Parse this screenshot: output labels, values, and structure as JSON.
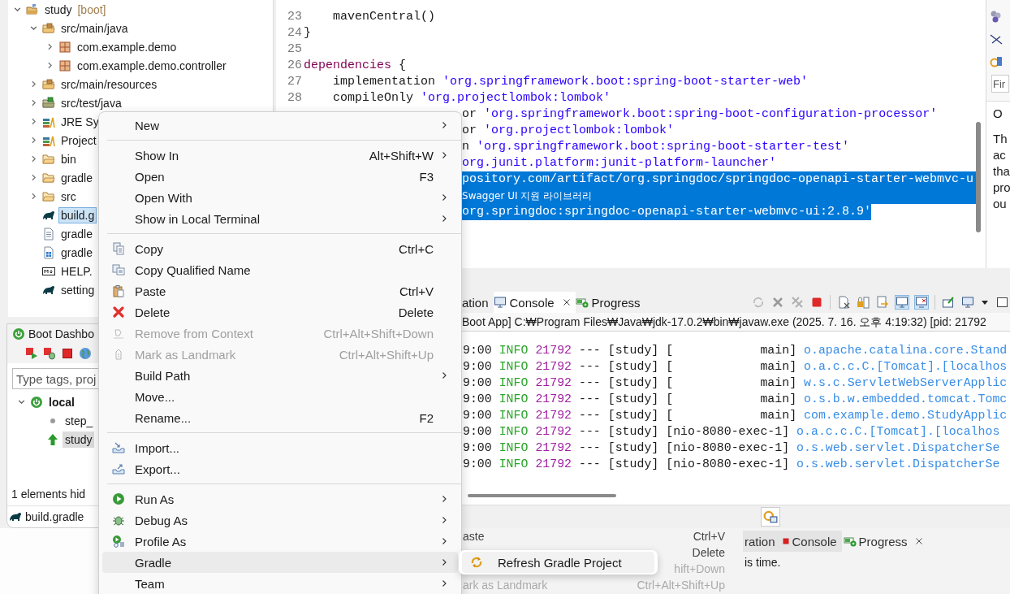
{
  "package_explorer": {
    "tree": [
      {
        "label": "study",
        "decoration": "[boot]",
        "kind": "project",
        "expanded": true,
        "selected": false,
        "children": [
          {
            "label": "src/main/java",
            "kind": "source-folder",
            "expanded": true,
            "selected": false,
            "children": [
              {
                "label": "com.example.demo",
                "kind": "package",
                "expanded": false,
                "selected": false
              },
              {
                "label": "com.example.demo.controller",
                "kind": "package",
                "expanded": false,
                "selected": false
              }
            ]
          },
          {
            "label": "src/main/resources",
            "kind": "source-folder",
            "expanded": false,
            "selected": false
          },
          {
            "label": "src/test/java",
            "kind": "test-folder",
            "expanded": false,
            "selected": false
          },
          {
            "label": "JRE Sy",
            "kind": "library",
            "expanded": false,
            "selected": false
          },
          {
            "label": "Project",
            "kind": "library",
            "expanded": false,
            "selected": false
          },
          {
            "label": "bin",
            "kind": "folder",
            "expanded": false,
            "selected": false
          },
          {
            "label": "gradle",
            "kind": "folder",
            "expanded": false,
            "selected": false
          },
          {
            "label": "src",
            "kind": "folder",
            "expanded": false,
            "selected": false
          },
          {
            "label": "build.g",
            "kind": "gradle-file",
            "selected": true
          },
          {
            "label": "gradle",
            "kind": "text-file",
            "selected": false
          },
          {
            "label": "gradle",
            "kind": "batch-file",
            "selected": false
          },
          {
            "label": "HELP.",
            "kind": "markdown-file",
            "selected": false
          },
          {
            "label": "setting",
            "kind": "gradle-file",
            "selected": false
          }
        ]
      }
    ]
  },
  "boot_dashboard": {
    "title": "Boot Dashbo",
    "search": {
      "placeholder": "Type tags, proj"
    },
    "tree": [
      {
        "label": "local",
        "kind": "target",
        "expanded": true,
        "selected": false,
        "children": [
          {
            "label": "step_",
            "kind": "stopped",
            "selected": false
          },
          {
            "label": "study",
            "kind": "running",
            "selected": true
          }
        ]
      }
    ],
    "status": "1 elements hid",
    "footer": "build.gradle"
  },
  "editor": {
    "lines": [
      {
        "number": "23",
        "indented": true,
        "selected": false,
        "segments": [
          {
            "text": "mavenCentral()",
            "kind": "plain"
          }
        ]
      },
      {
        "number": "24",
        "indented": false,
        "selected": false,
        "segments": [
          {
            "text": "}",
            "kind": "plain"
          }
        ]
      },
      {
        "number": "25"
      },
      {
        "number": "26",
        "indented": false,
        "selected": false,
        "segments": [
          {
            "text": "dependencies",
            "kind": "keyword"
          },
          {
            "text": "{",
            "kind": "plain"
          }
        ]
      },
      {
        "number": "27",
        "indented": true,
        "selected": false,
        "segments": [
          {
            "text": "implementation",
            "kind": "plain"
          },
          {
            "text": "'org.springframework.boot:spring-boot-starter-web'",
            "kind": "string"
          }
        ]
      },
      {
        "number": "28",
        "indented": true,
        "selected": false,
        "segments": [
          {
            "text": "compileOnly",
            "kind": "plain"
          },
          {
            "text": "'org.projectlombok:lombok'",
            "kind": "string"
          }
        ]
      },
      {
        "selected": false,
        "segments": [
          {
            "text": "or",
            "kind": "plain"
          },
          {
            "text": "'org.springframework.boot:spring-boot-configuration-processor'",
            "kind": "string"
          }
        ]
      },
      {
        "selected": false,
        "segments": [
          {
            "text": "or",
            "kind": "plain"
          },
          {
            "text": "'org.projectlombok:lombok'",
            "kind": "string"
          }
        ]
      },
      {
        "selected": false,
        "segments": [
          {
            "text": "n",
            "kind": "plain"
          },
          {
            "text": "'org.springframework.boot:spring-boot-starter-test'",
            "kind": "string"
          }
        ]
      },
      {
        "selected": false,
        "segments": [
          {
            "text": "org.junit.platform:junit-platform-launcher'",
            "kind": "string"
          }
        ]
      },
      {
        "selected": true,
        "segments": [
          {
            "text": "pository.com/artifact/org.springdoc/springdoc-openapi-starter-webmvc-u",
            "kind": "comment"
          }
        ]
      },
      {
        "selected": true,
        "segments": [
          {
            "text": "Swagger UI 지원 라이브러리",
            "kind": "localized-comment"
          }
        ]
      },
      {
        "selected": true,
        "segments": [
          {
            "text": "org.springdoc:springdoc-openapi-starter-webmvc-ui:2.8.9'",
            "kind": "string"
          }
        ]
      }
    ]
  },
  "right_panel": {
    "search": {
      "placeholder": "Fir"
    },
    "heading": "O",
    "lines": [
      "Th",
      "ac",
      "tha",
      "pro",
      "ou"
    ]
  },
  "console": {
    "tabs": [
      {
        "label": "ation",
        "kind": "plain",
        "selected": false
      },
      {
        "label": "Console",
        "kind": "console",
        "selected": true
      },
      {
        "label": "Progress",
        "kind": "progress",
        "selected": false
      }
    ],
    "header": "Boot App] C:₩Program Files₩Java₩jdk-17.0.2₩bin₩javaw.exe  (2025. 7. 16. 오후 4:19:32) [pid: 21792",
    "rows": [
      {
        "time": "9:00",
        "level": "INFO",
        "pid": "21792",
        "separator": "---",
        "app": "[study]",
        "thread": "[            main]",
        "logger": "o.apache.catalina.core.Stand"
      },
      {
        "time": "9:00",
        "level": "INFO",
        "pid": "21792",
        "separator": "---",
        "app": "[study]",
        "thread": "[            main]",
        "logger": "o.a.c.c.C.[Tomcat].[localhos"
      },
      {
        "time": "9:00",
        "level": "INFO",
        "pid": "21792",
        "separator": "---",
        "app": "[study]",
        "thread": "[            main]",
        "logger": "w.s.c.ServletWebServerApplic"
      },
      {
        "time": "9:00",
        "level": "INFO",
        "pid": "21792",
        "separator": "---",
        "app": "[study]",
        "thread": "[            main]",
        "logger": "o.s.b.w.embedded.tomcat.Tomc"
      },
      {
        "time": "9:00",
        "level": "INFO",
        "pid": "21792",
        "separator": "---",
        "app": "[study]",
        "thread": "[            main]",
        "logger": "com.example.demo.StudyApplic"
      },
      {
        "time": "9:00",
        "level": "INFO",
        "pid": "21792",
        "separator": "---",
        "app": "[study]",
        "thread": "[nio-8080-exec-1]",
        "logger": "o.a.c.c.C.[Tomcat].[localhos"
      },
      {
        "time": "9:00",
        "level": "INFO",
        "pid": "21792",
        "separator": "---",
        "app": "[study]",
        "thread": "[nio-8080-exec-1]",
        "logger": "o.s.web.servlet.DispatcherSe"
      },
      {
        "time": "9:00",
        "level": "INFO",
        "pid": "21792",
        "separator": "---",
        "app": "[study]",
        "thread": "[nio-8080-exec-1]",
        "logger": "o.s.web.servlet.DispatcherSe"
      }
    ]
  },
  "context_menu": {
    "items": [
      {
        "kind": "plain",
        "label": "New",
        "submenu": true,
        "disabled": false,
        "selected": false
      },
      {
        "kind": "separator"
      },
      {
        "kind": "plain",
        "label": "Show In",
        "shortcut": "Alt+Shift+W",
        "submenu": true,
        "disabled": false,
        "selected": false
      },
      {
        "kind": "plain",
        "label": "Open",
        "shortcut": "F3",
        "submenu": false,
        "disabled": false,
        "selected": false
      },
      {
        "kind": "plain",
        "label": "Open With",
        "submenu": true,
        "disabled": false,
        "selected": false
      },
      {
        "kind": "plain",
        "label": "Show in Local Terminal",
        "submenu": true,
        "disabled": false,
        "selected": false
      },
      {
        "kind": "separator"
      },
      {
        "kind": "copy",
        "label": "Copy",
        "shortcut": "Ctrl+C",
        "submenu": false,
        "disabled": false,
        "selected": false
      },
      {
        "kind": "copy-name",
        "label": "Copy Qualified Name",
        "submenu": false,
        "disabled": false,
        "selected": false
      },
      {
        "kind": "paste",
        "label": "Paste",
        "shortcut": "Ctrl+V",
        "submenu": false,
        "disabled": false,
        "selected": false
      },
      {
        "kind": "delete",
        "label": "Delete",
        "shortcut": "Delete",
        "submenu": false,
        "disabled": false,
        "selected": false
      },
      {
        "kind": "remove-context",
        "label": "Remove from Context",
        "shortcut": "Ctrl+Alt+Shift+Down",
        "submenu": false,
        "disabled": true,
        "selected": false
      },
      {
        "kind": "landmark",
        "label": "Mark as Landmark",
        "shortcut": "Ctrl+Alt+Shift+Up",
        "submenu": false,
        "disabled": true,
        "selected": false
      },
      {
        "kind": "plain",
        "label": "Build Path",
        "submenu": true,
        "disabled": false,
        "selected": false
      },
      {
        "kind": "plain",
        "label": "Move...",
        "submenu": false,
        "disabled": false,
        "selected": false
      },
      {
        "kind": "plain",
        "label": "Rename...",
        "shortcut": "F2",
        "submenu": false,
        "disabled": false,
        "selected": false
      },
      {
        "kind": "separator"
      },
      {
        "kind": "import",
        "label": "Import...",
        "submenu": false,
        "disabled": false,
        "selected": false
      },
      {
        "kind": "export",
        "label": "Export...",
        "submenu": false,
        "disabled": false,
        "selected": false
      },
      {
        "kind": "separator"
      },
      {
        "kind": "run",
        "label": "Run As",
        "submenu": true,
        "disabled": false,
        "selected": false
      },
      {
        "kind": "debug",
        "label": "Debug As",
        "submenu": true,
        "disabled": false,
        "selected": false
      },
      {
        "kind": "profile",
        "label": "Profile As",
        "submenu": true,
        "disabled": false,
        "selected": false
      },
      {
        "kind": "plain",
        "label": "Gradle",
        "submenu": true,
        "disabled": false,
        "selected": true
      },
      {
        "kind": "plain",
        "label": "Team",
        "submenu": true,
        "disabled": false,
        "selected": false
      }
    ]
  },
  "submenu": {
    "items": [
      {
        "label": "Refresh Gradle Project",
        "selected": true
      }
    ]
  },
  "background_window": {
    "menu_rows": [
      {
        "label": "aste",
        "shortcut": "Ctrl+V",
        "disabled": false
      },
      {
        "shortcut": "Delete",
        "disabled": false
      },
      {
        "shortcut": "hift+Down",
        "disabled": true
      },
      {
        "label": "ark as Landmark",
        "shortcut": "Ctrl+Alt+Shift+Up",
        "disabled": true
      }
    ],
    "tabs": [
      {
        "label": "ration",
        "kind": "plain",
        "selected": false
      },
      {
        "label": "Console",
        "kind": "console-stopped",
        "selected": false
      },
      {
        "label": "Progress",
        "kind": "progress",
        "selected": true
      }
    ],
    "message": "is time."
  }
}
